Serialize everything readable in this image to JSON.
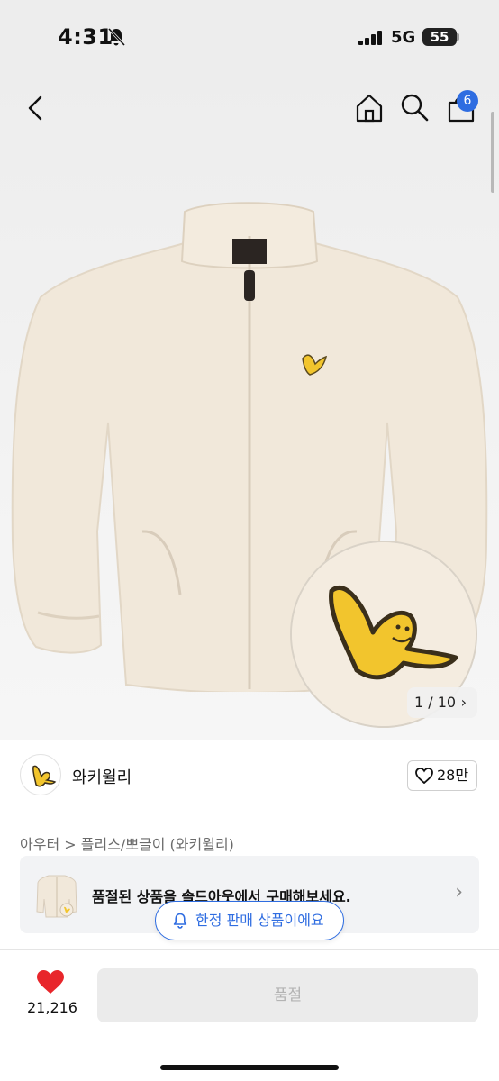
{
  "status_bar": {
    "time": "4:31",
    "network": "5G",
    "battery": "55"
  },
  "header": {
    "cart_count": "6",
    "icons": [
      "back-arrow-icon",
      "home-icon",
      "search-icon",
      "cart-icon"
    ]
  },
  "gallery": {
    "page_indicator": "1 / 10",
    "chevron": "›"
  },
  "brand": {
    "name": "와키윌리",
    "likes": "28만"
  },
  "breadcrumb": {
    "category": "아우터",
    "separator": " > ",
    "subcategory": "플리스/뽀글이 (와키윌리)"
  },
  "soldout_banner": {
    "text": "품절된 상품을 솔드아웃에서 구매해보세요.",
    "chevron": "›"
  },
  "limited_notice": {
    "text": "한정 판매 상품이에요"
  },
  "bottom_bar": {
    "wish_count": "21,216",
    "buy_label": "품절"
  },
  "colors": {
    "accent": "#2f6de1",
    "heart": "#e8262b",
    "jacket": "#f1e8da",
    "logo_yellow": "#f2c52d"
  }
}
